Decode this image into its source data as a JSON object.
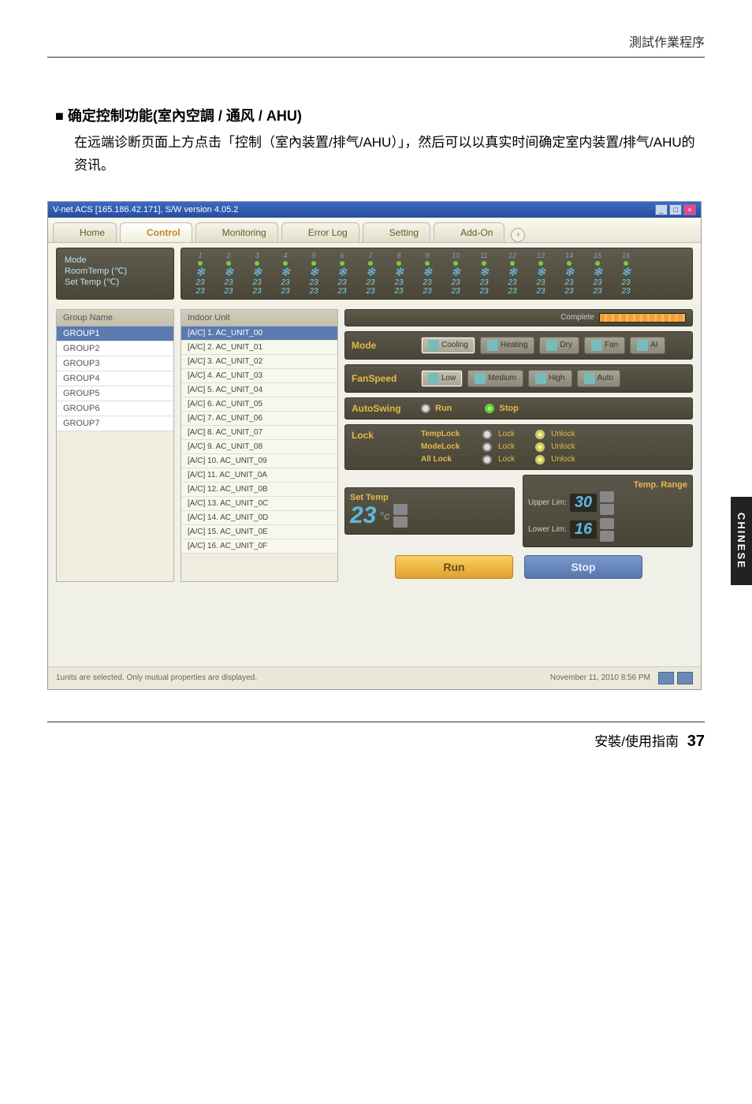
{
  "doc": {
    "header_right": "測試作業程序",
    "section_title": "■ 确定控制功能(室內空調 / 通风 / AHU)",
    "section_body": "在远端诊断页面上方点击「控制（室內装置/排气/AHU）」，然后可以以真实时间确定室内装置/排气/AHU的资讯。",
    "side_tab": "CHINESE",
    "footer_label": "安裝/使用指南",
    "page_number": "37"
  },
  "app": {
    "title": "V-net ACS [165.186.42.171],  S/W version 4.05.2",
    "tabs": [
      "Home",
      "Control",
      "Monitoring",
      "Error Log",
      "Setting",
      "Add-On"
    ],
    "active_tab": 1,
    "modebox": {
      "mode": "Mode",
      "roomtemp": "RoomTemp (℃)",
      "settemp": "Set Temp  (℃)"
    },
    "units": {
      "count": 16,
      "room": 23,
      "set": 23
    },
    "group_head": "Group Name",
    "groups": [
      "GROUP1",
      "GROUP2",
      "GROUP3",
      "GROUP4",
      "GROUP5",
      "GROUP6",
      "GROUP7"
    ],
    "indoor_head": "Indoor Unit",
    "indoor": [
      "[A/C] 1. AC_UNIT_00",
      "[A/C] 2. AC_UNIT_01",
      "[A/C] 3. AC_UNIT_02",
      "[A/C] 4. AC_UNIT_03",
      "[A/C] 5. AC_UNIT_04",
      "[A/C] 6. AC_UNIT_05",
      "[A/C] 7. AC_UNIT_06",
      "[A/C] 8. AC_UNIT_07",
      "[A/C] 9. AC_UNIT_08",
      "[A/C] 10. AC_UNIT_09",
      "[A/C] 11. AC_UNIT_0A",
      "[A/C] 12. AC_UNIT_0B",
      "[A/C] 13. AC_UNIT_0C",
      "[A/C] 14. AC_UNIT_0D",
      "[A/C] 15. AC_UNIT_0E",
      "[A/C] 16. AC_UNIT_0F"
    ],
    "complete": "Complete",
    "ctrl": {
      "mode": {
        "label": "Mode",
        "opts": [
          "Cooling",
          "Heating",
          "Dry",
          "Fan",
          "AI"
        ],
        "sel": 0
      },
      "fan": {
        "label": "FanSpeed",
        "opts": [
          "Low",
          "Medium",
          "High",
          "Auto"
        ],
        "sel": 0
      },
      "swing": {
        "label": "AutoSwing",
        "run": "Run",
        "stop": "Stop",
        "val": "stop"
      },
      "lock": {
        "label": "Lock",
        "rows": [
          {
            "name": "TempLock",
            "lock": "Lock",
            "unlock": "Unlock"
          },
          {
            "name": "ModeLock",
            "lock": "Lock",
            "unlock": "Unlock"
          },
          {
            "name": "All Lock",
            "lock": "Lock",
            "unlock": "Unlock"
          }
        ]
      },
      "settemp": {
        "label": "Set Temp",
        "value": "23",
        "unit": "°c",
        "range_label": "Temp. Range",
        "upper": "Upper Lim:",
        "upper_val": "30",
        "lower": "Lower Lim:",
        "lower_val": "16"
      },
      "run": "Run",
      "stop": "Stop"
    },
    "status": {
      "msg": "1units are selected. Only mutual properties are displayed.",
      "time": "November 11, 2010  8:56 PM"
    }
  }
}
